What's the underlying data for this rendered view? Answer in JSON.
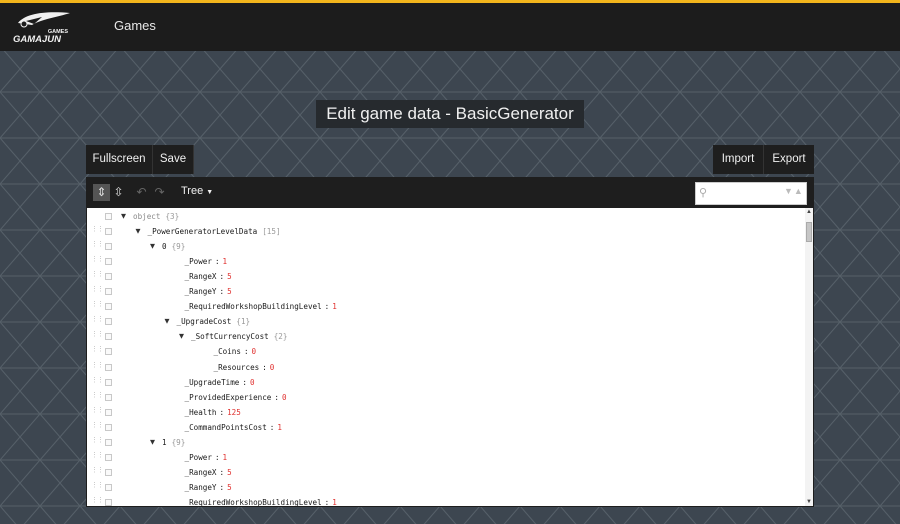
{
  "header": {
    "logo_text": "GAMAJUN",
    "logo_sub": "GAMES",
    "nav_games": "Games"
  },
  "page": {
    "title": "Edit game data - BasicGenerator"
  },
  "toolbar": {
    "fullscreen": "Fullscreen",
    "save": "Save",
    "import": "Import",
    "export": "Export"
  },
  "editor": {
    "mode": "Tree",
    "icons": {
      "expand_all": "expand-all-icon",
      "collapse_all": "collapse-all-icon",
      "undo": "undo-icon",
      "redo": "redo-icon",
      "search": "search-icon"
    },
    "search": {
      "placeholder": "",
      "value": ""
    }
  },
  "colors": {
    "accent": "#f2b51c",
    "value": "#e0312f",
    "header_bg": "#1c1c1c"
  },
  "tree": [
    {
      "depth": 0,
      "toggle": "▼",
      "key": "object",
      "count": "{3}",
      "value": null,
      "obj": true
    },
    {
      "depth": 1,
      "toggle": "▼",
      "key": "_PowerGeneratorLevelData",
      "count": "[15]",
      "value": null
    },
    {
      "depth": 2,
      "toggle": "▼",
      "key": "0",
      "count": "{9}",
      "value": null,
      "obj": true
    },
    {
      "depth": 3,
      "toggle": "",
      "key": "_Power",
      "count": "",
      "value": "1"
    },
    {
      "depth": 3,
      "toggle": "",
      "key": "_RangeX",
      "count": "",
      "value": "5"
    },
    {
      "depth": 3,
      "toggle": "",
      "key": "_RangeY",
      "count": "",
      "value": "5"
    },
    {
      "depth": 3,
      "toggle": "",
      "key": "_RequiredWorkshopBuildingLevel",
      "count": "",
      "value": "1"
    },
    {
      "depth": 3,
      "toggle": "▼",
      "key": "_UpgradeCost",
      "count": "{1}",
      "value": null
    },
    {
      "depth": 4,
      "toggle": "▼",
      "key": "_SoftCurrencyCost",
      "count": "{2}",
      "value": null
    },
    {
      "depth": 5,
      "toggle": "",
      "key": "_Coins",
      "count": "",
      "value": "0"
    },
    {
      "depth": 5,
      "toggle": "",
      "key": "_Resources",
      "count": "",
      "value": "0"
    },
    {
      "depth": 3,
      "toggle": "",
      "key": "_UpgradeTime",
      "count": "",
      "value": "0"
    },
    {
      "depth": 3,
      "toggle": "",
      "key": "_ProvidedExperience",
      "count": "",
      "value": "0"
    },
    {
      "depth": 3,
      "toggle": "",
      "key": "_Health",
      "count": "",
      "value": "125"
    },
    {
      "depth": 3,
      "toggle": "",
      "key": "_CommandPointsCost",
      "count": "",
      "value": "1"
    },
    {
      "depth": 2,
      "toggle": "▼",
      "key": "1",
      "count": "{9}",
      "value": null,
      "obj": true
    },
    {
      "depth": 3,
      "toggle": "",
      "key": "_Power",
      "count": "",
      "value": "1"
    },
    {
      "depth": 3,
      "toggle": "",
      "key": "_RangeX",
      "count": "",
      "value": "5"
    },
    {
      "depth": 3,
      "toggle": "",
      "key": "_RangeY",
      "count": "",
      "value": "5"
    },
    {
      "depth": 3,
      "toggle": "",
      "key": "_RequiredWorkshopBuildingLevel",
      "count": "",
      "value": "1"
    }
  ]
}
